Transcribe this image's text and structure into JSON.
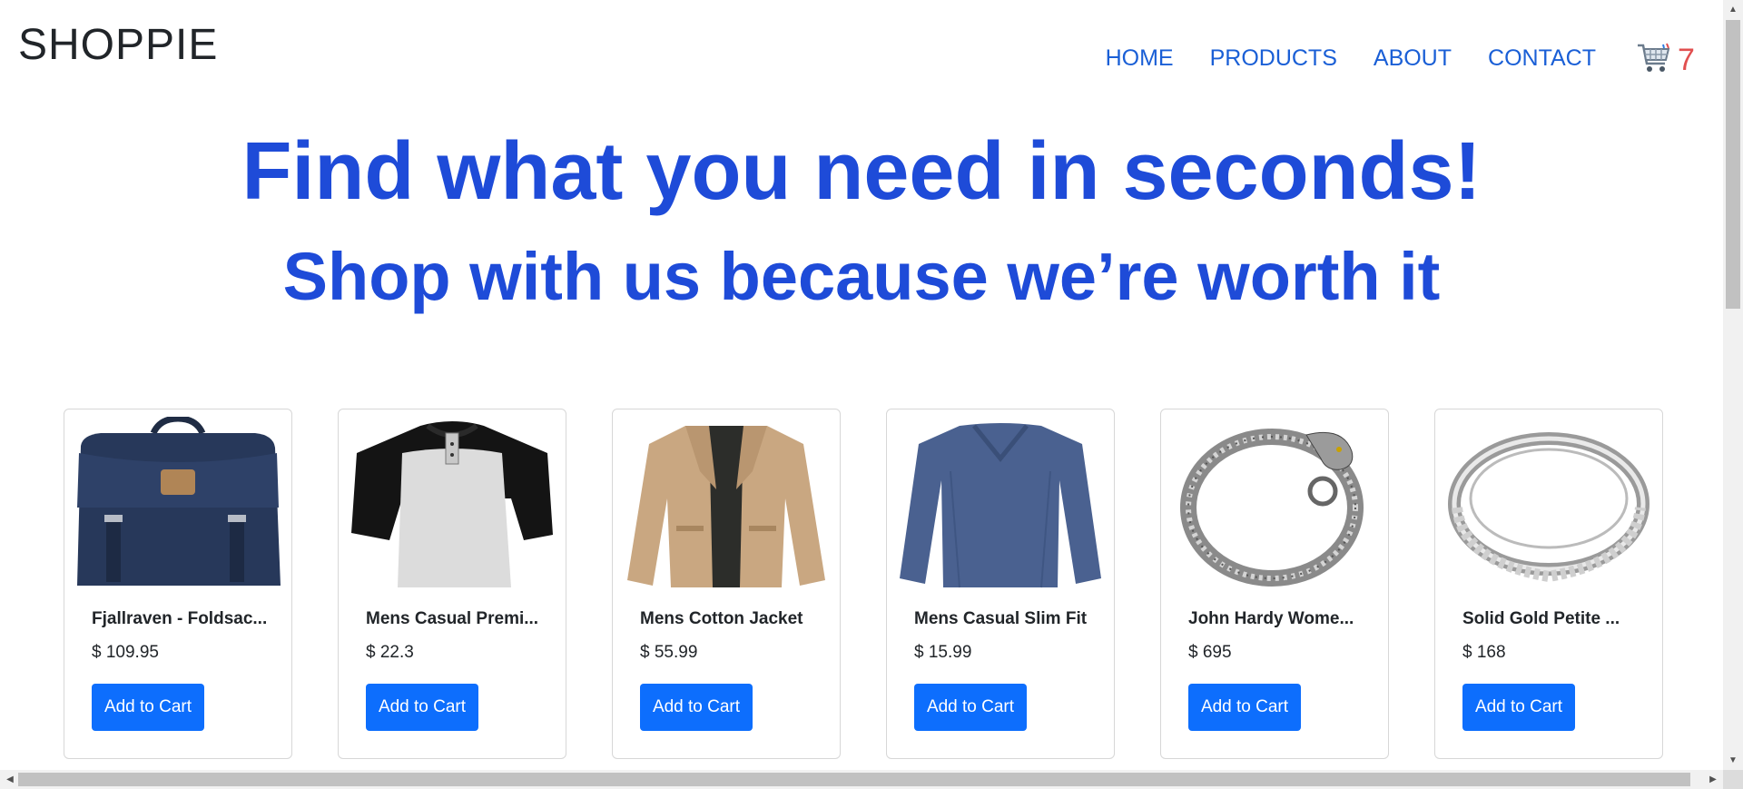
{
  "brand": "SHOPPIE",
  "nav": {
    "items": [
      {
        "label": "HOME"
      },
      {
        "label": "PRODUCTS"
      },
      {
        "label": "ABOUT"
      },
      {
        "label": "CONTACT"
      }
    ]
  },
  "cart": {
    "icon": "shopping-cart-icon",
    "count": "7"
  },
  "hero": {
    "title": "Find what you need in seconds!",
    "subtitle": "Shop with us because we’re worth it"
  },
  "products": [
    {
      "title": "Fjallraven - Foldsac...",
      "price": "$ 109.95",
      "button": "Add to Cart",
      "image": "backpack-image"
    },
    {
      "title": "Mens Casual Premi...",
      "price": "$ 22.3",
      "button": "Add to Cart",
      "image": "raglan-tshirt-image"
    },
    {
      "title": "Mens Cotton Jacket",
      "price": "$ 55.99",
      "button": "Add to Cart",
      "image": "jacket-image"
    },
    {
      "title": "Mens Casual Slim Fit",
      "price": "$ 15.99",
      "button": "Add to Cart",
      "image": "longsleeve-shirt-image"
    },
    {
      "title": "John Hardy Wome...",
      "price": "$ 695",
      "button": "Add to Cart",
      "image": "dragon-bracelet-image"
    },
    {
      "title": "Solid Gold Petite ...",
      "price": "$ 168",
      "button": "Add to Cart",
      "image": "ring-image"
    }
  ],
  "colors": {
    "accent": "#1e4bd8",
    "nav": "#1a5fd6",
    "button": "#0d6efd",
    "cart_count": "#e14f4f"
  }
}
